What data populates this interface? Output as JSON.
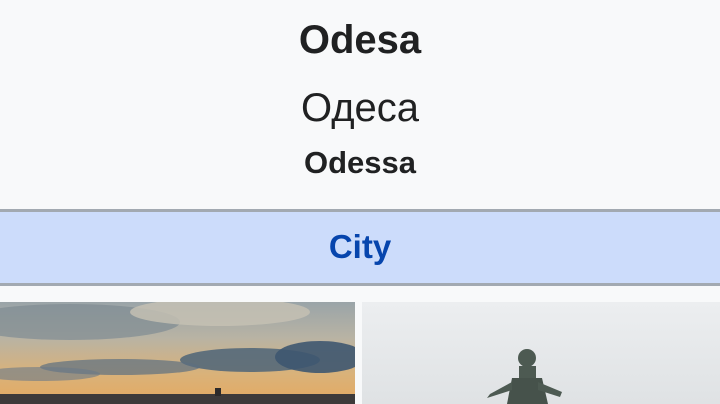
{
  "infobox": {
    "title_en": "Odesa",
    "title_native": "Одеса",
    "title_alt": "Odessa",
    "settlement_type": "City"
  },
  "images": [
    {
      "icon": "sunset-sky-photo"
    },
    {
      "icon": "statue-monument-photo"
    }
  ],
  "colors": {
    "background": "#f8f9fa",
    "type_row": "#ccdcfb",
    "link": "#0645ad",
    "border": "#a2a9b1"
  }
}
